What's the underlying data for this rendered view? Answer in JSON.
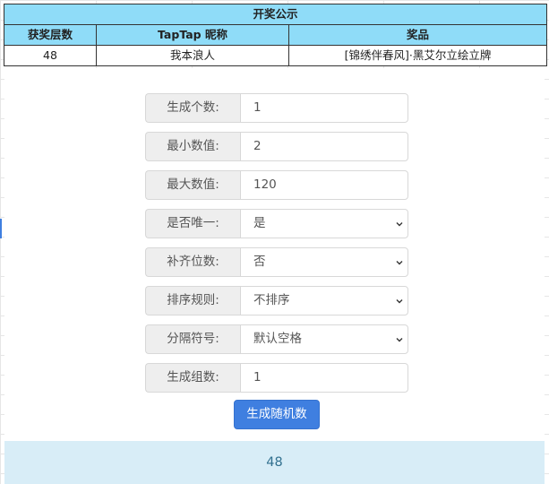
{
  "announcement": {
    "title": "开奖公示",
    "headers": [
      "获奖层数",
      "TapTap 昵称",
      "奖品"
    ],
    "rows": [
      {
        "floor": "48",
        "nickname": "我本浪人",
        "prize": "[锦绣伴春风]·黑艾尔立绘立牌"
      }
    ]
  },
  "generator": {
    "fields": [
      {
        "label": "生成个数:",
        "value": "1",
        "type": "input"
      },
      {
        "label": "最小数值:",
        "value": "2",
        "type": "input"
      },
      {
        "label": "最大数值:",
        "value": "120",
        "type": "input"
      },
      {
        "label": "是否唯一:",
        "value": "是",
        "type": "select"
      },
      {
        "label": "补齐位数:",
        "value": "否",
        "type": "select"
      },
      {
        "label": "排序规则:",
        "value": "不排序",
        "type": "select"
      },
      {
        "label": "分隔符号:",
        "value": "默认空格",
        "type": "select"
      },
      {
        "label": "生成组数:",
        "value": "1",
        "type": "input"
      }
    ],
    "button_label": "生成随机数",
    "result": "48"
  },
  "colors": {
    "table_header_bg": "#8fdcf8",
    "button_bg": "#3f7fe0",
    "result_bg": "#d8edf7",
    "result_text": "#31708f"
  }
}
